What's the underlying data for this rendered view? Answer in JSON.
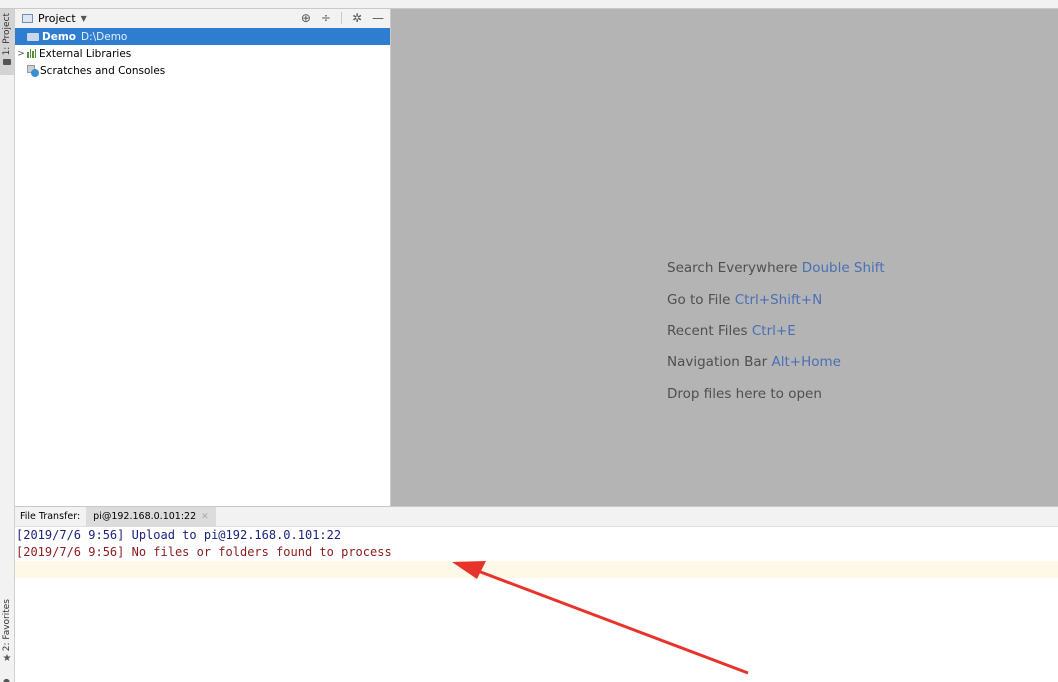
{
  "tool_stripe": {
    "project_tab": "1: Project",
    "favorites_tab": "2: Favorites"
  },
  "project_panel": {
    "title": "Project",
    "tree": [
      {
        "name": "Demo",
        "path": "D:\\Demo",
        "selected": true
      },
      {
        "name": "External Libraries"
      },
      {
        "name": "Scratches and Consoles"
      }
    ]
  },
  "editor": {
    "hints": [
      {
        "label": "Search Everywhere",
        "shortcut": "Double Shift"
      },
      {
        "label": "Go to File",
        "shortcut": "Ctrl+Shift+N"
      },
      {
        "label": "Recent Files",
        "shortcut": "Ctrl+E"
      },
      {
        "label": "Navigation Bar",
        "shortcut": "Alt+Home"
      },
      {
        "label": "Drop files here to open",
        "shortcut": ""
      }
    ]
  },
  "file_transfer": {
    "label": "File Transfer:",
    "tab": "pi@192.168.0.101:22",
    "log": [
      {
        "text": "[2019/7/6 9:56] Upload to pi@192.168.0.101:22",
        "level": "info"
      },
      {
        "text": "[2019/7/6 9:56] No files or folders found to process",
        "level": "error"
      }
    ]
  },
  "colors": {
    "selection": "#2f7dd1",
    "editor_bg": "#b4b4b4",
    "shortcut": "#4a6fb5",
    "log_info": "#1a237e",
    "log_error": "#8b1b1b",
    "annotation_arrow": "#e8332a"
  }
}
